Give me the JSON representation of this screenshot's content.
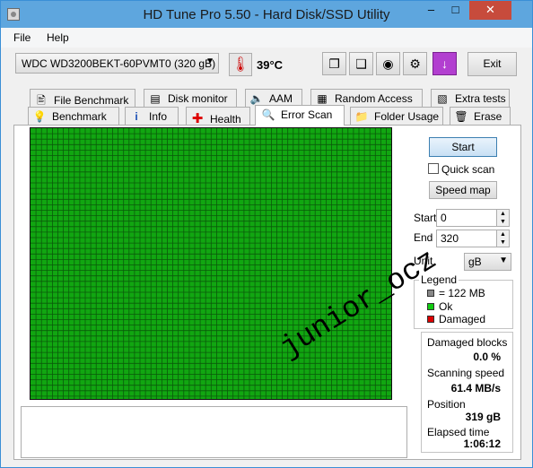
{
  "window": {
    "title": "HD Tune Pro 5.50 - Hard Disk/SSD Utility",
    "min_glyph": "–",
    "max_glyph": "□",
    "close_glyph": "✕"
  },
  "menu": {
    "file": "File",
    "help": "Help"
  },
  "toolbar": {
    "drive": "WDC WD3200BEKT-60PVMT0 (320 gB)",
    "temperature": "39°C",
    "exit_label": "Exit",
    "icons": [
      "copy-icon",
      "copy-text-icon",
      "camera-icon",
      "settings-icon",
      "save-icon"
    ]
  },
  "tabs_top": [
    {
      "label": "File Benchmark",
      "icon": "file-benchmark-icon"
    },
    {
      "label": "Disk monitor",
      "icon": "disk-monitor-icon"
    },
    {
      "label": "AAM",
      "icon": "speaker-icon"
    },
    {
      "label": "Random Access",
      "icon": "random-access-icon"
    },
    {
      "label": "Extra tests",
      "icon": "extra-tests-icon"
    }
  ],
  "tabs_bottom": [
    {
      "label": "Benchmark",
      "icon": "benchmark-icon"
    },
    {
      "label": "Info",
      "icon": "info-icon"
    },
    {
      "label": "Health",
      "icon": "health-icon"
    },
    {
      "label": "Error Scan",
      "icon": "error-scan-icon",
      "active": true
    },
    {
      "label": "Folder Usage",
      "icon": "folder-icon"
    },
    {
      "label": "Erase",
      "icon": "erase-icon"
    }
  ],
  "scan": {
    "start_label": "Start",
    "quick_scan_label": "Quick scan",
    "quick_scan_checked": false,
    "speed_map_label": "Speed map",
    "start_field_label": "Start",
    "start_value": "0",
    "end_field_label": "End",
    "end_value": "320",
    "unit_label": "Unit",
    "unit_value": "gB",
    "grid_color": "#11a611"
  },
  "legend": {
    "title": "Legend",
    "block": "= 122 MB",
    "ok": "Ok",
    "damaged": "Damaged",
    "colors": {
      "block": "#888888",
      "ok": "#11cc11",
      "damaged": "#dd0000"
    }
  },
  "stats": {
    "damaged_blocks_label": "Damaged blocks",
    "damaged_blocks_value": "0.0 %",
    "scanning_speed_label": "Scanning speed",
    "scanning_speed_value": "61.4 MB/s",
    "position_label": "Position",
    "position_value": "319 gB",
    "elapsed_time_label": "Elapsed time",
    "elapsed_time_value": "1:06:12"
  },
  "watermark": "junior_ocz"
}
